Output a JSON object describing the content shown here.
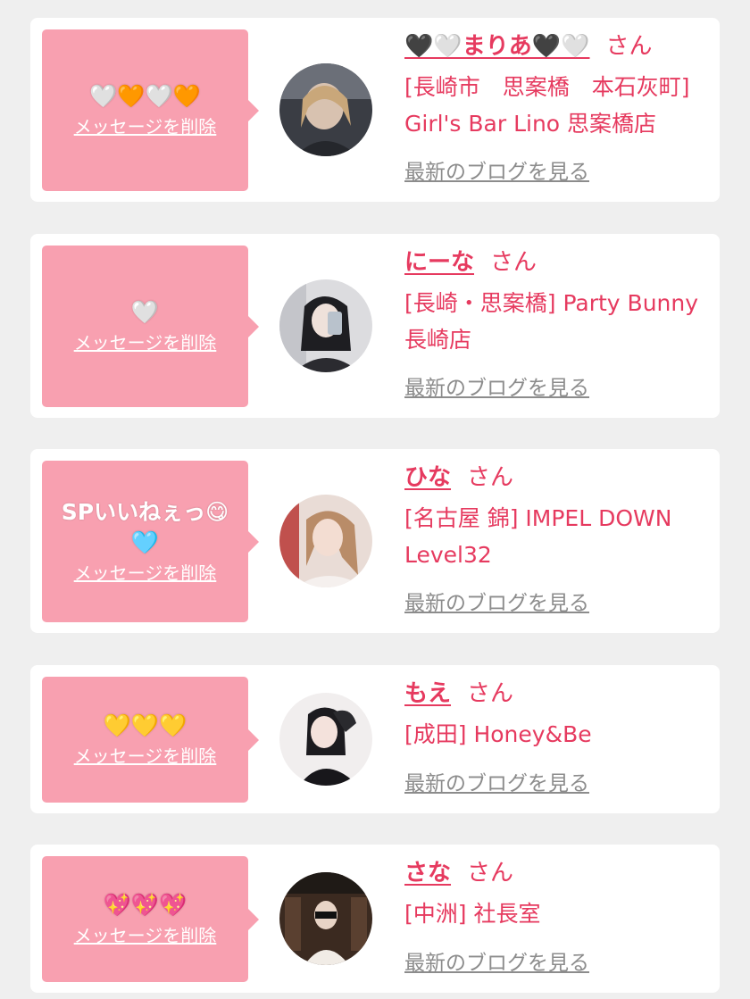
{
  "delete_label": "メッセージを削除",
  "san_label": "さん",
  "blog_label": "最新のブログを見る",
  "items": [
    {
      "message": "🤍🧡🤍🧡",
      "name": "🖤🤍まりあ🖤🤍",
      "shop": "[長崎市　思案橋　本石灰町] Girl's Bar Lino 思案橋店"
    },
    {
      "message": "🤍",
      "name": "にーな",
      "shop": "[長崎・思案橋] Party Bunny 長崎店"
    },
    {
      "message": "SPいいねぇっ😋🩵",
      "name": "ひな",
      "shop": "[名古屋 錦] IMPEL DOWN Level32"
    },
    {
      "message": "💛💛💛",
      "name": "もえ",
      "shop": "[成田] Honey&Be"
    },
    {
      "message": "💖💖💖",
      "name": "さな",
      "shop": "[中洲] 社長室"
    }
  ],
  "colors": {
    "accent": "#e63a5f",
    "bubble": "#f8a0b0",
    "link_gray": "#8c8c8c",
    "background": "#efefef"
  }
}
